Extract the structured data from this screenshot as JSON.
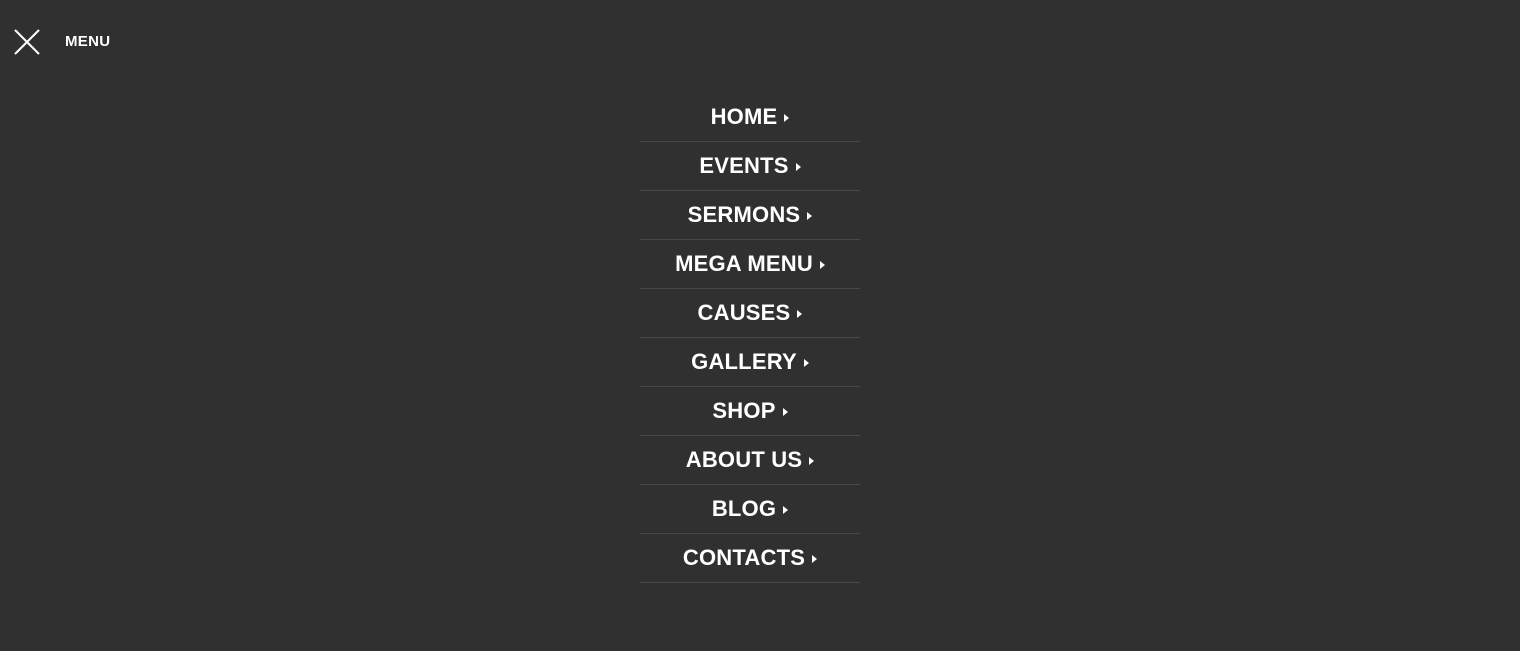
{
  "colors": {
    "background": "#303030",
    "text": "#ffffff",
    "divider": "#484848"
  },
  "header": {
    "close_icon": "close-x-icon",
    "menu_label": "MENU"
  },
  "nav": {
    "caret_icon": "caret-right-icon",
    "items": [
      {
        "label": "HOME"
      },
      {
        "label": "EVENTS"
      },
      {
        "label": "SERMONS"
      },
      {
        "label": "MEGA MENU"
      },
      {
        "label": "CAUSES"
      },
      {
        "label": "GALLERY"
      },
      {
        "label": "SHOP"
      },
      {
        "label": "ABOUT US"
      },
      {
        "label": "BLOG"
      },
      {
        "label": "CONTACTS"
      }
    ]
  }
}
